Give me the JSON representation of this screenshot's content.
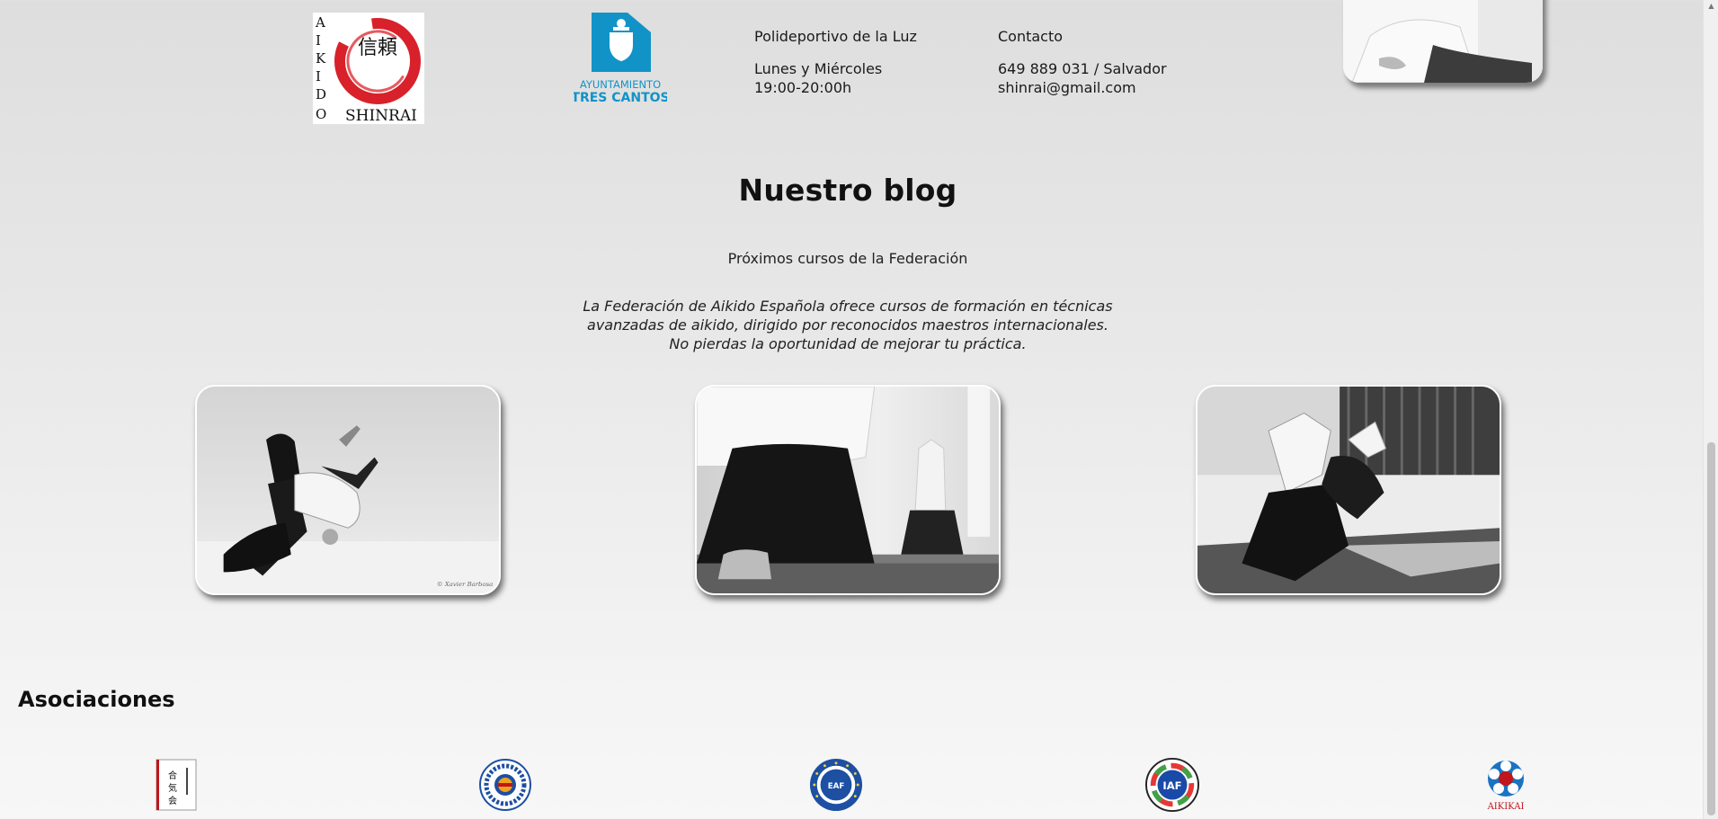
{
  "top_info": {
    "shinrai_logo": {
      "name": "aikido-shinrai-logo",
      "vertical_text": "AIKIDO",
      "bottom_text": "SHINRAI",
      "kanji": "信頼"
    },
    "tres_cantos_logo": {
      "line1": "AYUNTAMIENTO",
      "line2": "TRES CANTOS"
    },
    "venue": {
      "name": "Polideportivo de la Luz",
      "days": "Lunes y Miércoles",
      "hours": "19:00-20:00h"
    },
    "contact": {
      "heading": "Contacto",
      "phone": "649 889 031 / Salvador",
      "email": "shinrai@gmail.com"
    }
  },
  "blog": {
    "title": "Nuestro blog",
    "subtitle": "Próximos cursos de la Federación",
    "description_lines": [
      "La Federación de Aikido Española ofrece cursos de formación en técnicas",
      "avanzadas de aikido, dirigido por reconocidos maestros internacionales.",
      "No pierdas la oportunidad de mejorar tu práctica."
    ],
    "photos": [
      {
        "name": "aikido-throw-photo",
        "credit": "© Xavier Barbosa"
      },
      {
        "name": "aikido-kneeling-photo"
      },
      {
        "name": "aikido-technique-photo"
      }
    ]
  },
  "asociaciones": {
    "title": "Asociaciones",
    "logos": [
      {
        "name": "aikikai-calligraphy-logo",
        "text": "合気会"
      },
      {
        "name": "federacion-espanola-logo"
      },
      {
        "name": "eaf-logo",
        "text": "EAF"
      },
      {
        "name": "iaf-logo",
        "text": "IAF"
      },
      {
        "name": "aikikai-foundation-logo",
        "text": "AIKIKAI"
      }
    ]
  },
  "colors": {
    "tres_cantos_blue": "#1193c8",
    "shinrai_red": "#d8212a",
    "iaf_blue": "#1a4aa8",
    "eaf_blue": "#1d4fa3",
    "aikikai_red": "#c0161c",
    "aikikai_blue": "#1b73c2"
  }
}
